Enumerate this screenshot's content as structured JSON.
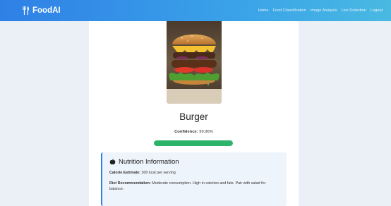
{
  "brand": {
    "name": "FoodAI",
    "icon": "utensils-icon"
  },
  "nav": {
    "links": [
      "Home",
      "Food Classification",
      "Image Analysis",
      "Live Detection",
      "Logout"
    ]
  },
  "result": {
    "food_name": "Burger",
    "confidence_label": "Confidence:",
    "confidence_value": "99.96%",
    "confidence_fraction": 0.9996
  },
  "nutrition": {
    "title": "Nutrition Information",
    "icon": "apple-icon",
    "calorie_label": "Calorie Estimate:",
    "calorie_value": "300 kcal per serving",
    "diet_label": "Diet Recommendation:",
    "diet_value": "Moderate consumption. High in calories and fats. Pair with salad for balance."
  },
  "colors": {
    "nav_start": "#2f80e6",
    "nav_end": "#49b9e2",
    "progress": "#2db36a",
    "accent": "#2f80e6"
  }
}
